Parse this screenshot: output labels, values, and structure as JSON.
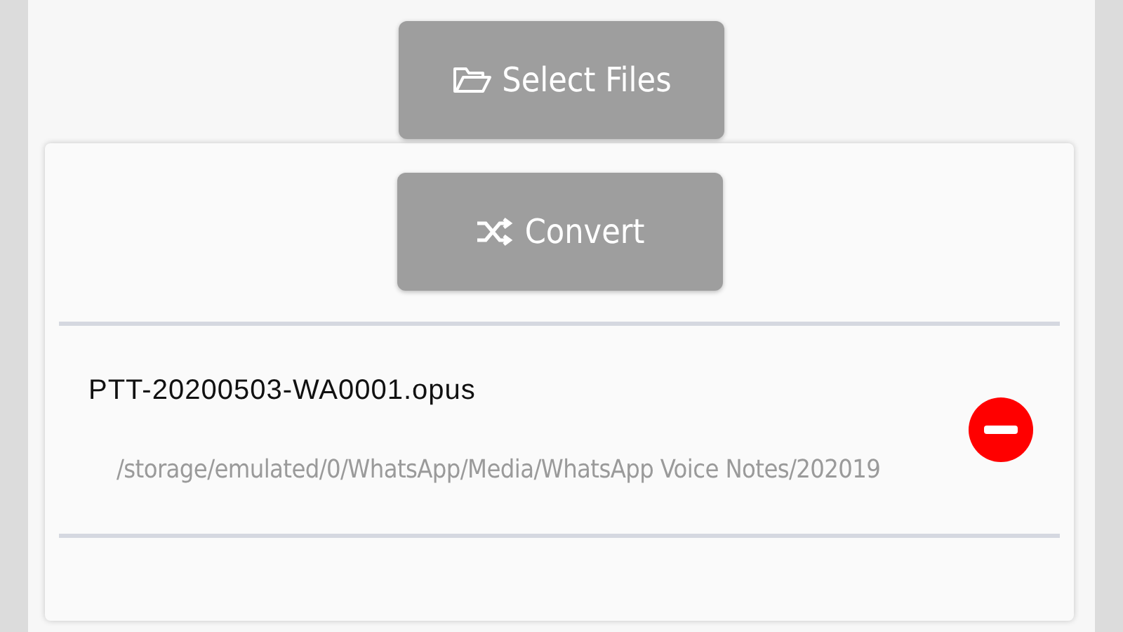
{
  "select_button": {
    "label": "Select Files"
  },
  "convert_button": {
    "label": "Convert"
  },
  "files": [
    {
      "name": "PTT-20200503-WA0001.opus",
      "path": "/storage/emulated/0/WhatsApp/Media/WhatsApp Voice Notes/202019"
    }
  ]
}
